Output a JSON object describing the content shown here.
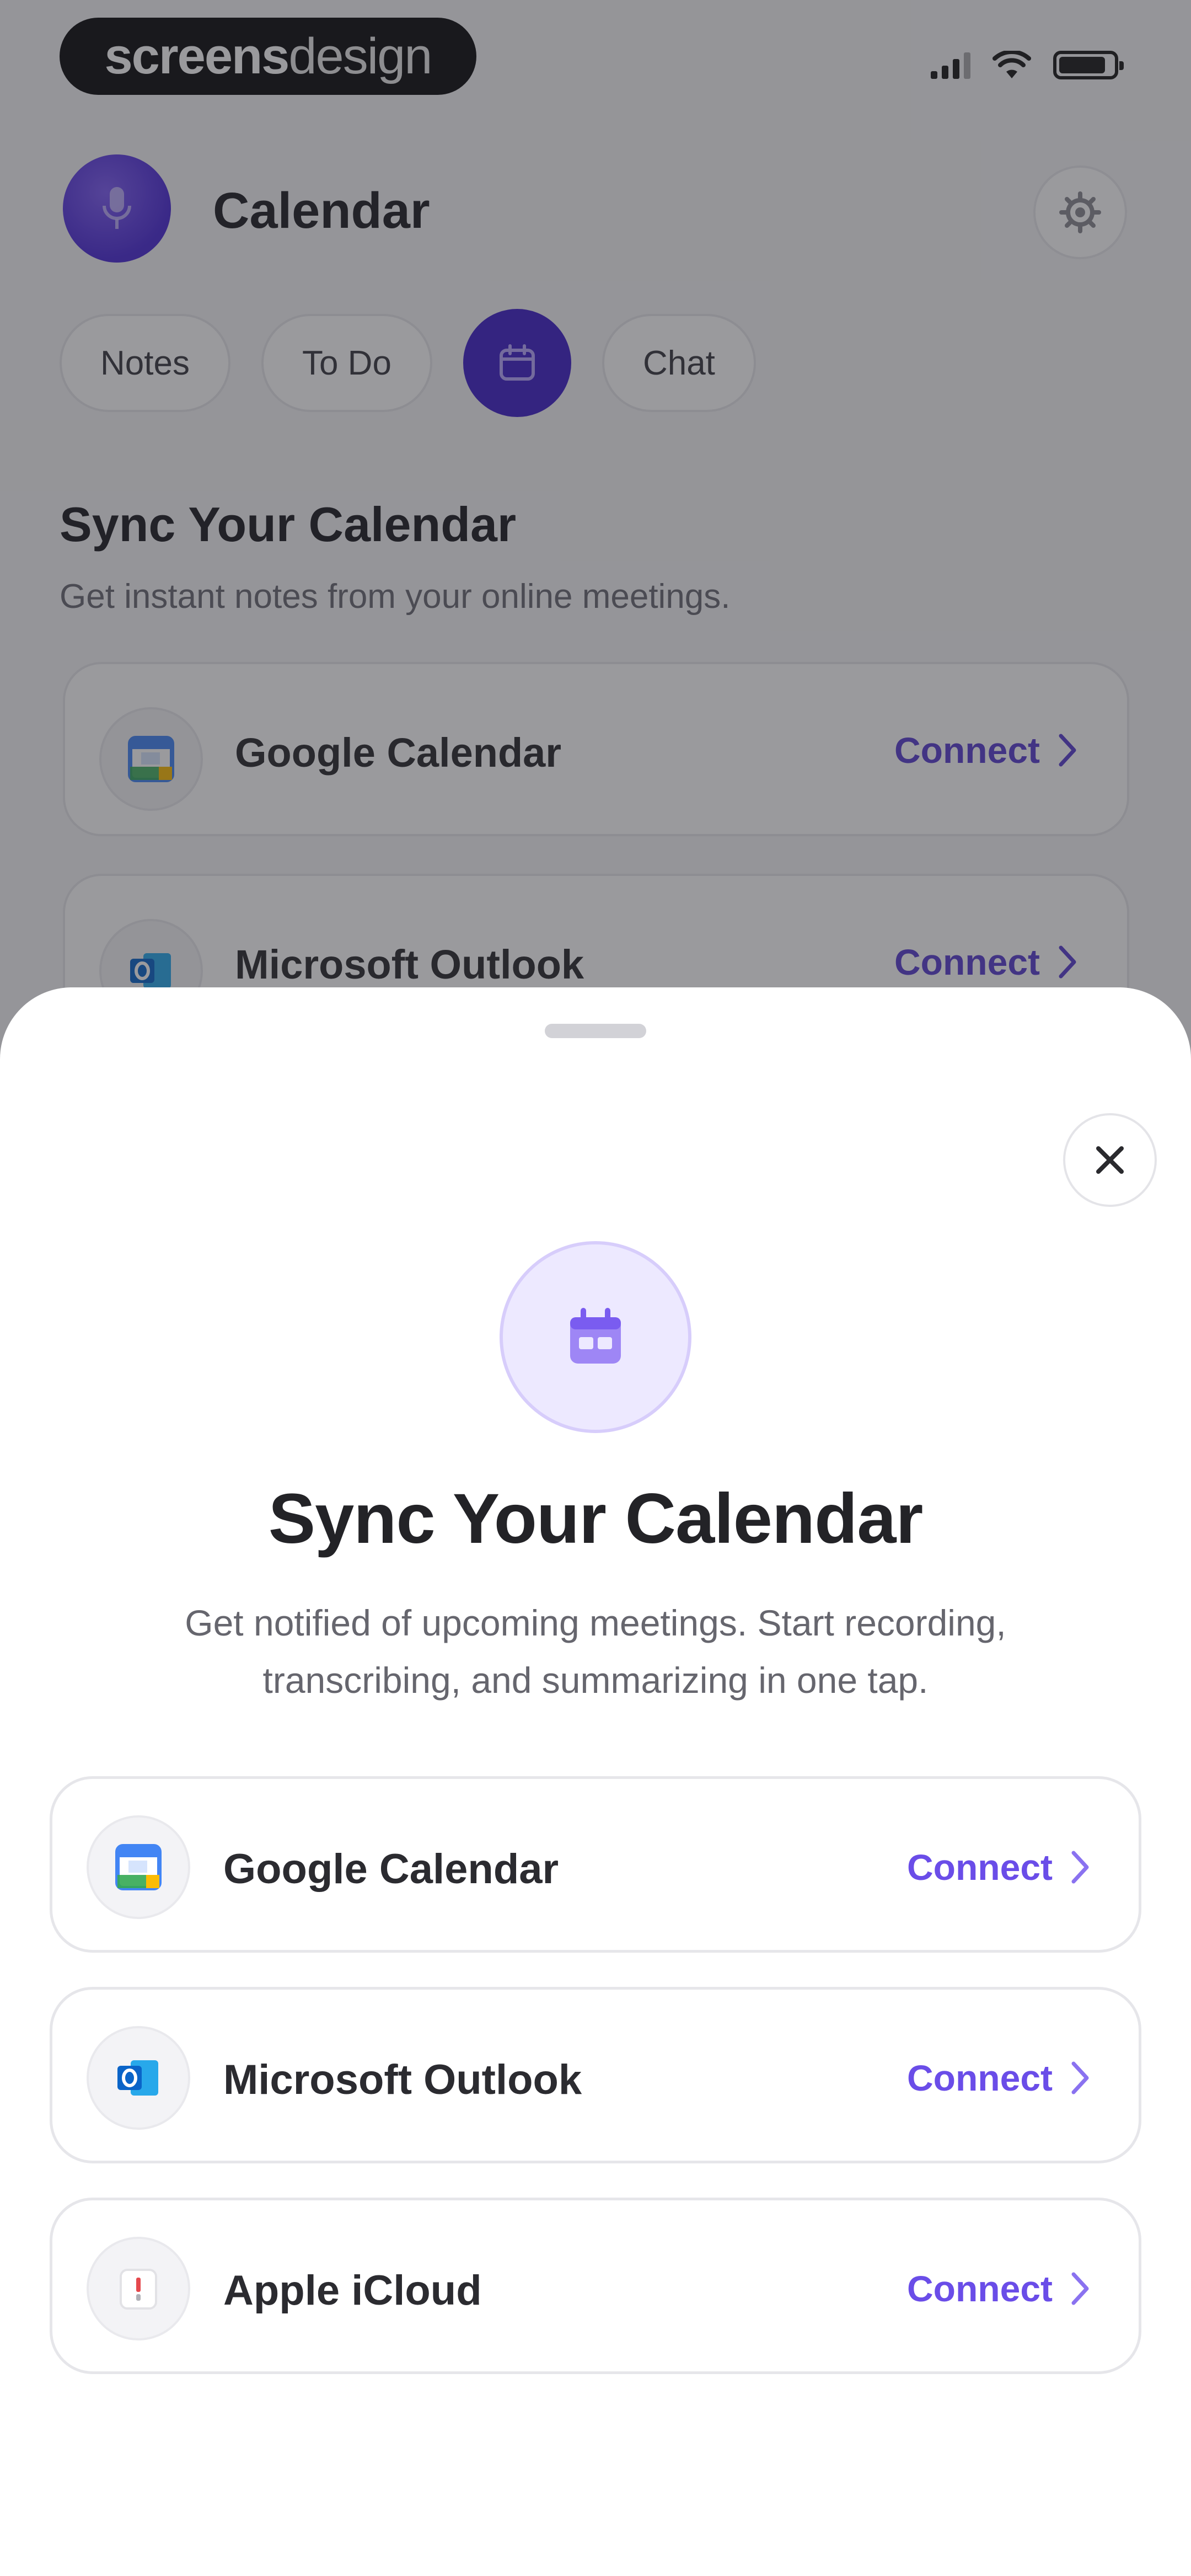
{
  "status_bar": {
    "watermark_bold": "screens",
    "watermark_thin": "design"
  },
  "header": {
    "title": "Calendar"
  },
  "tabs": [
    {
      "label": "Notes"
    },
    {
      "label": "To Do"
    },
    {
      "label": "",
      "icon": "calendar-icon",
      "active": true
    },
    {
      "label": "Chat"
    }
  ],
  "background": {
    "title": "Sync Your Calendar",
    "subtitle": "Get instant notes from your online meetings.",
    "cards": [
      {
        "name": "Google Calendar",
        "action": "Connect"
      },
      {
        "name": "Microsoft Outlook",
        "action": "Connect"
      }
    ]
  },
  "sheet": {
    "title": "Sync Your Calendar",
    "subtitle": "Get notified of upcoming meetings. Start recording, transcribing, and summarizing in one tap.",
    "providers": [
      {
        "name": "Google Calendar",
        "action": "Connect",
        "icon": "google-calendar-icon"
      },
      {
        "name": "Microsoft Outlook",
        "action": "Connect",
        "icon": "outlook-icon"
      },
      {
        "name": "Apple iCloud",
        "action": "Connect",
        "icon": "icloud-calendar-icon"
      }
    ]
  },
  "colors": {
    "accent": "#3f21c9",
    "connect": "#6a4de8",
    "hero_bg": "#ede9ff"
  }
}
